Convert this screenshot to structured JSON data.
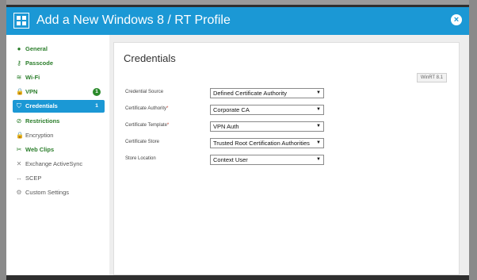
{
  "window": {
    "title": "Add a New Windows 8 / RT Profile",
    "close_label": "×",
    "accent_color": "#1b98d5"
  },
  "sidebar": {
    "items": [
      {
        "label": "General",
        "icon": "info-icon",
        "glyph": "●",
        "style": "green"
      },
      {
        "label": "Passcode",
        "icon": "key-icon",
        "glyph": "⚷",
        "style": "green"
      },
      {
        "label": "Wi-Fi",
        "icon": "wifi-icon",
        "glyph": "≋",
        "style": "green"
      },
      {
        "label": "VPN",
        "icon": "lock-icon",
        "glyph": "🔒",
        "style": "plain-dark",
        "badge": "1"
      },
      {
        "label": "Credentials",
        "icon": "shield-icon",
        "glyph": "⛉",
        "style": "active",
        "badge": "1"
      },
      {
        "label": "Restrictions",
        "icon": "no-entry-icon",
        "glyph": "⊘",
        "style": "green"
      },
      {
        "label": "Encryption",
        "icon": "lock-icon",
        "glyph": "🔒",
        "style": "plain"
      },
      {
        "label": "Web Clips",
        "icon": "scissors-icon",
        "glyph": "✂",
        "style": "green"
      },
      {
        "label": "Exchange ActiveSync",
        "icon": "exchange-icon",
        "glyph": "✕",
        "style": "plain"
      },
      {
        "label": "SCEP",
        "icon": "arrows-icon",
        "glyph": "↔",
        "style": "plain"
      },
      {
        "label": "Custom Settings",
        "icon": "gear-icon",
        "glyph": "⚙",
        "style": "plain"
      }
    ]
  },
  "main": {
    "title": "Credentials",
    "version_badge": "WinRT 8.1",
    "fields": [
      {
        "label": "Credential Source",
        "required": false,
        "value": "Defined Certificate Authority"
      },
      {
        "label": "Certificate Authority",
        "required": true,
        "value": "Corporate CA"
      },
      {
        "label": "Certificate Template",
        "required": true,
        "value": "VPN Auth"
      },
      {
        "label": "Certificate Store",
        "required": false,
        "value": "Trusted Root Certification Authorities"
      },
      {
        "label": "Store Location",
        "required": false,
        "value": "Context User"
      }
    ],
    "required_marker": "*",
    "caret": "▼"
  }
}
